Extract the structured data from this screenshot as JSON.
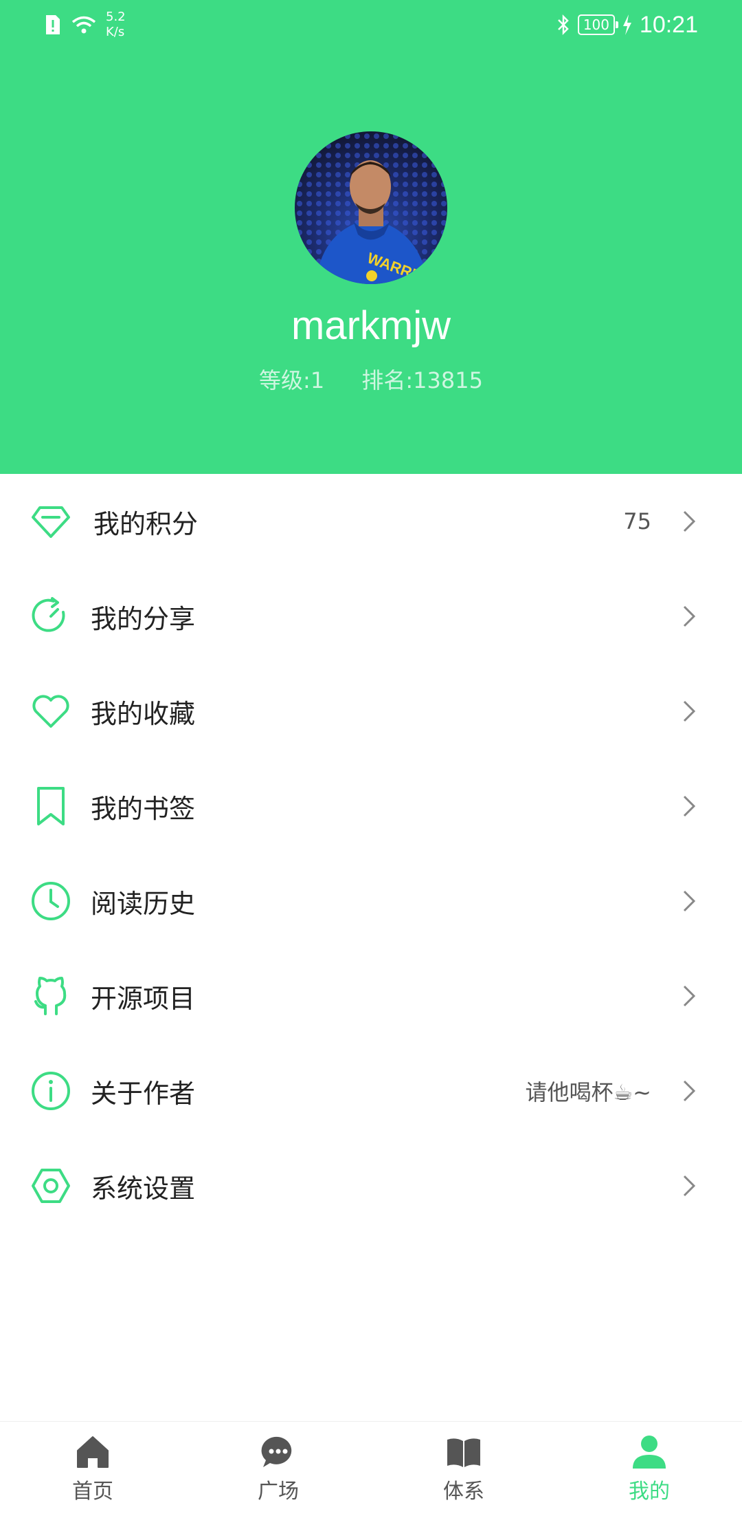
{
  "status_bar": {
    "net_speed_value": "5.2",
    "net_speed_unit": "K/s",
    "battery": "100",
    "time": "10:21"
  },
  "profile": {
    "username": "markmjw",
    "level": "等级:1",
    "rank": "排名:13815"
  },
  "menu": {
    "items": [
      {
        "label": "我的积分",
        "value": "75",
        "icon": "diamond-icon"
      },
      {
        "label": "我的分享",
        "value": "",
        "icon": "share-refresh-icon"
      },
      {
        "label": "我的收藏",
        "value": "",
        "icon": "heart-icon"
      },
      {
        "label": "我的书签",
        "value": "",
        "icon": "bookmark-icon"
      },
      {
        "label": "阅读历史",
        "value": "",
        "icon": "clock-icon"
      },
      {
        "label": "开源项目",
        "value": "",
        "icon": "github-icon"
      },
      {
        "label": "关于作者",
        "value": "请他喝杯☕~",
        "icon": "info-icon"
      },
      {
        "label": "系统设置",
        "value": "",
        "icon": "settings-icon"
      }
    ]
  },
  "bottom_nav": {
    "items": [
      {
        "label": "首页",
        "icon": "home-icon"
      },
      {
        "label": "广场",
        "icon": "chat-icon"
      },
      {
        "label": "体系",
        "icon": "book-icon"
      },
      {
        "label": "我的",
        "icon": "person-icon",
        "active": true
      }
    ]
  },
  "colors": {
    "accent": "#3ddc84",
    "inactive": "#555555"
  }
}
